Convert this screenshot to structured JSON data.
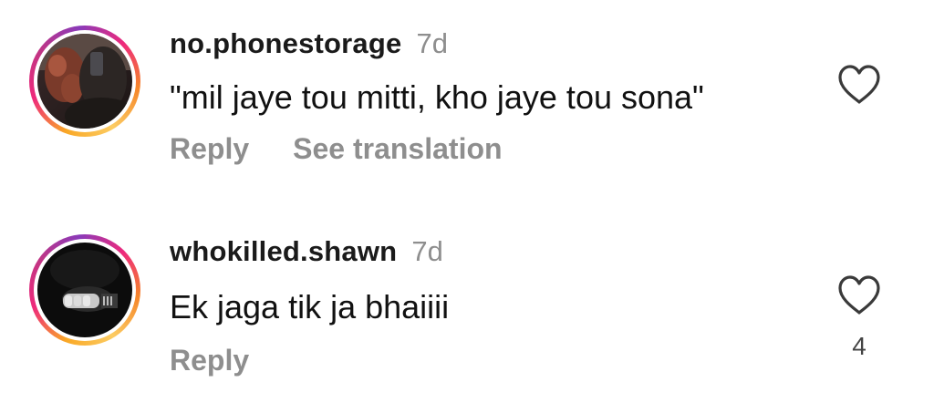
{
  "comments": [
    {
      "username": "no.phonestorage",
      "age": "7d",
      "text": "\"mil jaye tou mitti, kho jaye tou sona\"",
      "actions": [
        "Reply",
        "See translation"
      ],
      "like_count": ""
    },
    {
      "username": "whokilled.shawn",
      "age": "7d",
      "text": "Ek jaga tik ja bhaiiii",
      "actions": [
        "Reply"
      ],
      "like_count": "4"
    }
  ],
  "icons": {
    "like": "heart-outline-icon"
  },
  "colors": {
    "text": "#111111",
    "muted": "#8e8e8e",
    "ring": [
      "#f9a826",
      "#ee2a7b",
      "#c13584"
    ]
  }
}
